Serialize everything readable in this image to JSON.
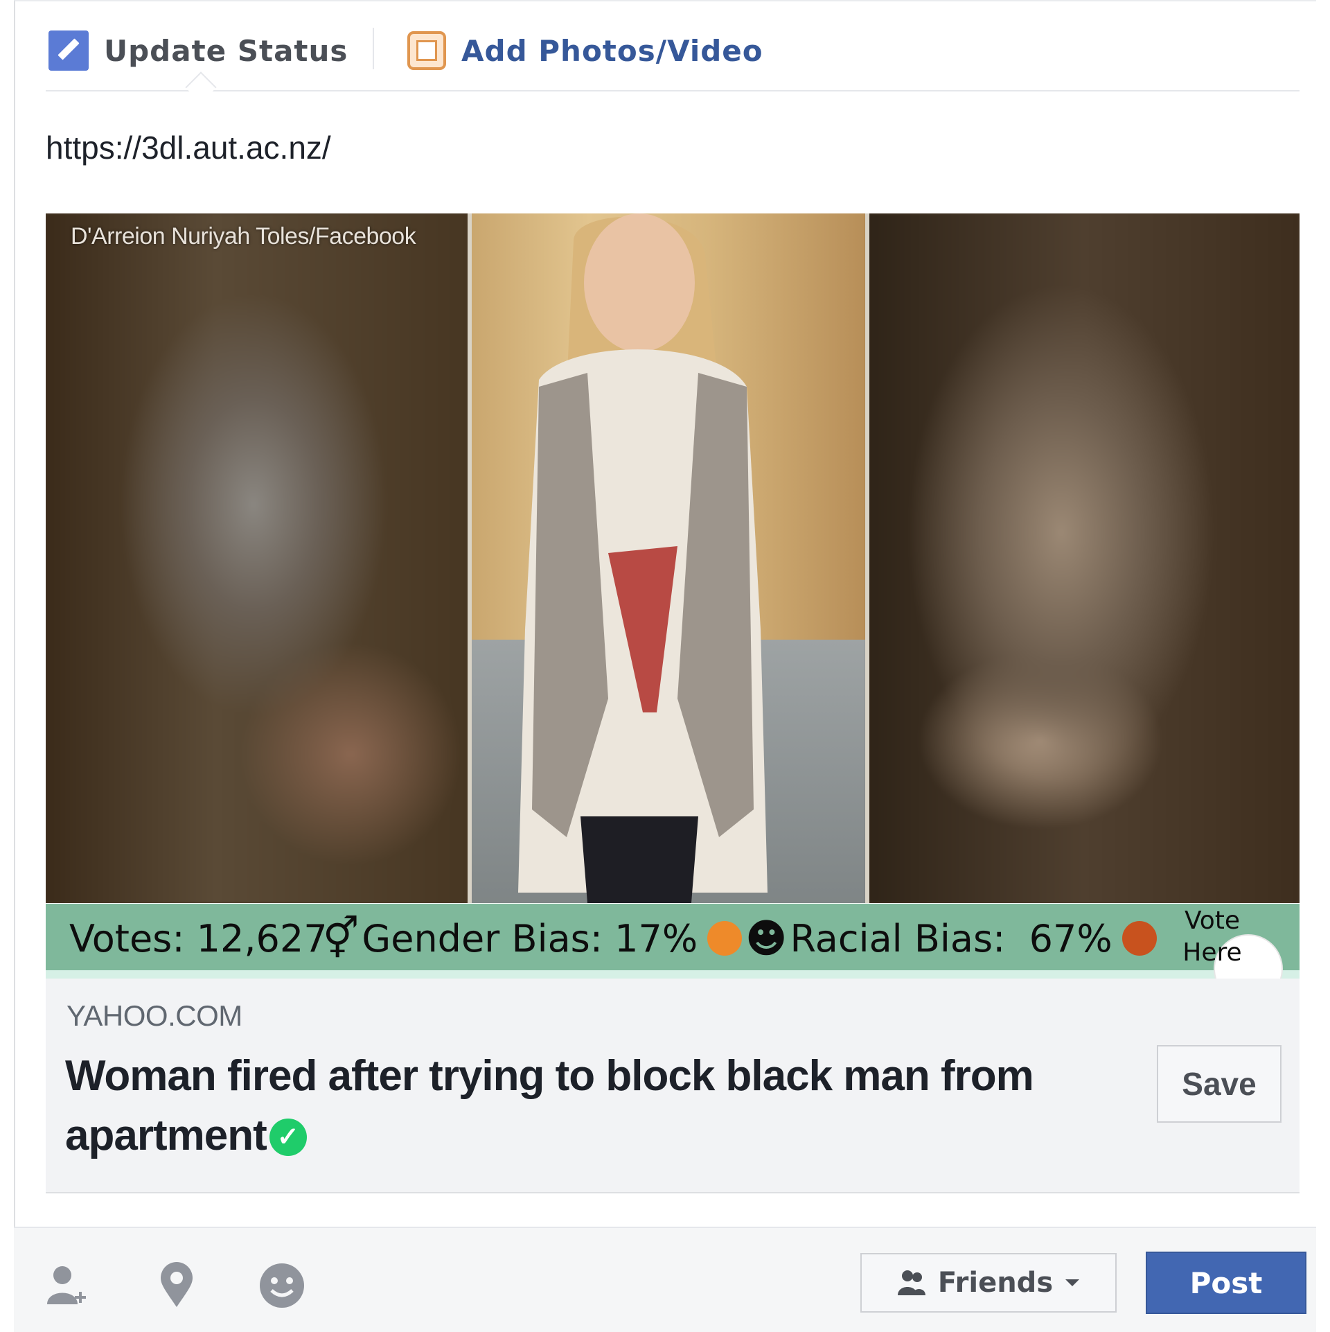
{
  "composer": {
    "tabs": [
      {
        "label": "Update Status",
        "icon": "pencil-icon"
      },
      {
        "label": "Add Photos/Video",
        "icon": "photo-icon"
      }
    ],
    "text": "https://3dl.aut.ac.nz/"
  },
  "media": {
    "credit": "D'Arreion Nuriyah Toles/Facebook"
  },
  "bias_bar": {
    "votes_label": "Votes: 12,627",
    "gender_symbol": "⚥",
    "gender_label": "Gender Bias: 17%",
    "gender_dot_color": "#ee8a2a",
    "racial_symbol": "☻",
    "racial_label": "Racial Bias:  67%",
    "racial_dot_color": "#c8521e",
    "vote_here_line1": "Vote",
    "vote_here_line2": "Here",
    "bar_color": "#7fb89b"
  },
  "link": {
    "domain": "YAHOO.COM",
    "headline": "Woman fired after trying to block black man from apartment",
    "verified_icon": "check-circle-icon",
    "save_label": "Save"
  },
  "footer": {
    "icons": [
      "tag-friends-icon",
      "location-icon",
      "feeling-icon"
    ],
    "audience_label": "Friends",
    "post_label": "Post",
    "post_color": "#4267b2"
  }
}
